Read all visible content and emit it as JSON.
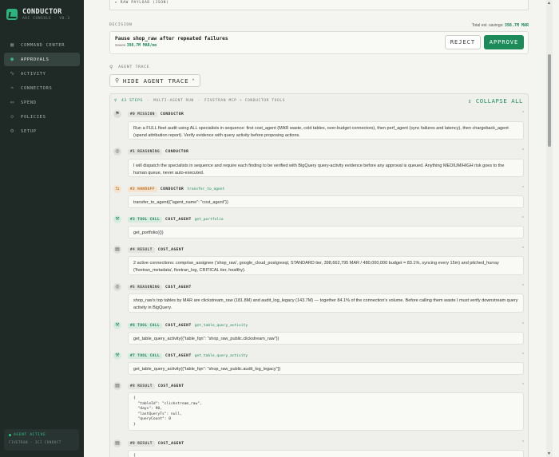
{
  "brand": {
    "name": "CONDUCTOR",
    "sub": "ARC CONSOLE · V0.3"
  },
  "nav": [
    {
      "label": "COMMAND CENTER",
      "icon": "grid-icon",
      "active": false
    },
    {
      "label": "APPROVALS",
      "icon": "check-circle-icon",
      "active": true
    },
    {
      "label": "ACTIVITY",
      "icon": "pulse-icon",
      "active": false
    },
    {
      "label": "CONNECTORS",
      "icon": "plug-icon",
      "active": false
    },
    {
      "label": "SPEND",
      "icon": "dollar-icon",
      "active": false
    },
    {
      "label": "POLICIES",
      "icon": "shield-icon",
      "active": false
    },
    {
      "label": "SETUP",
      "icon": "wrench-icon",
      "active": false
    }
  ],
  "agent_status": {
    "status": "AGENT ACTIVE",
    "sub": "FIVETRAN · ICI CONDUCT"
  },
  "raw_payload": "▸ RAW PAYLOAD (JSON)",
  "decision": {
    "section_label": "DECISION",
    "savings_label": "Total est. savings:",
    "savings_value": "398.7M MAR",
    "title": "Pause shop_raw after repeated failures",
    "saves_label": "Saves",
    "saves_value": "398.7M MAR/mo",
    "reject_label": "REJECT",
    "approve_label": "APPROVE"
  },
  "trace": {
    "section_label": "AGENT TRACE",
    "hide_label": "HIDE AGENT TRACE",
    "steps_count": "43 STEPS",
    "meta": [
      "·",
      "MULTI-AGENT RUN",
      "·",
      "FIVETRAN MCP + CONDUCTOR TOOLS"
    ],
    "collapse_label": "COLLAPSE ALL"
  },
  "steps": [
    {
      "tag": "#0 MISSION",
      "agent": "CONDUCTOR",
      "tool": "",
      "body": "Run a FULL fleet audit using ALL specialists in sequence: first cost_agent (MAR waste, cold tables, over-budget connectors), then perf_agent (sync failures and latency), then chargeback_agent (spend attribution report). Verify evidence with query activity before proposing actions."
    },
    {
      "tag": "#1 REASONING",
      "agent": "CONDUCTOR",
      "tool": "",
      "body": "I will dispatch the specialists in sequence and require each finding to be verified with BigQuery query-activity evidence before any approval is queued. Anything MEDIUM/HIGH risk goes to the human queue, never auto-executed."
    },
    {
      "tag": "#2 HANDOFF",
      "agent": "CONDUCTOR",
      "tool": "transfer_to_agent",
      "body": "transfer_to_agent({\"agent_name\": \"cost_agent\"})"
    },
    {
      "tag": "#3 TOOL CALL",
      "agent": "COST_AGENT",
      "tool": "get_portfolio",
      "body": "get_portfolio({})"
    },
    {
      "tag": "#4 RESULT",
      "agent": "COST_AGENT",
      "tool": "",
      "body": "2 active connections: comprise_assignee ('shop_raw', google_cloud_postgresql, STANDARD tier, 398,662,795 MAR / 480,000,000 budget = 83.1%, syncing every 15m) and pitched_hurray ('fivetran_metadata', fivetran_log, CRITICAL tier, healthy)."
    },
    {
      "tag": "#5 REASONING",
      "agent": "COST_AGENT",
      "tool": "",
      "body": "shop_raw's top tables by MAR are clickstream_raw (181.8M) and audit_log_legacy (143.7M) — together 84.1% of the connection's volume. Before calling them waste I must verify downstream query activity in BigQuery."
    },
    {
      "tag": "#6 TOOL CALL",
      "agent": "COST_AGENT",
      "tool": "get_table_query_activity",
      "body": "get_table_query_activity({\"table_fqn\": \"shop_raw_public.clickstream_raw\"})"
    },
    {
      "tag": "#7 TOOL CALL",
      "agent": "COST_AGENT",
      "tool": "get_table_query_activity",
      "body": "get_table_query_activity({\"table_fqn\": \"shop_raw_public.audit_log_legacy\"})"
    },
    {
      "tag": "#8 RESULT",
      "agent": "COST_AGENT",
      "tool": "",
      "body": "{\n  \"tableId\": \"clickstream_raw\",\n  \"days\": 90,\n  \"lastQueryTs\": null,\n  \"queryCount\": 0\n}"
    },
    {
      "tag": "#9 RESULT",
      "agent": "COST_AGENT",
      "tool": "",
      "body": "{"
    }
  ]
}
